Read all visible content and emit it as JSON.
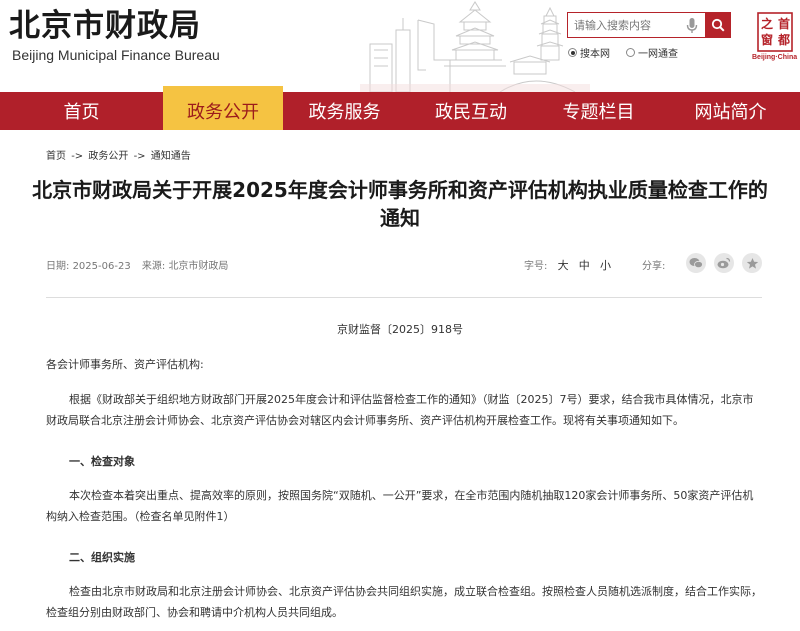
{
  "header": {
    "logo_cn": "北京市财政局",
    "logo_en": "Beijing Municipal Finance Bureau",
    "search_placeholder": "请输入搜索内容",
    "scope_options": [
      "搜本网",
      "一网通查"
    ],
    "seal_chars": [
      "首",
      "都",
      "之",
      "窗"
    ],
    "seal_caption": "Beijing·China",
    "accent_color": "#b0202a"
  },
  "nav": {
    "items": [
      "首页",
      "政务公开",
      "政务服务",
      "政民互动",
      "专题栏目",
      "网站简介"
    ],
    "active_index": 1,
    "active_color": "#f5c342"
  },
  "breadcrumb": [
    "首页",
    "->",
    "政务公开",
    "->",
    "通知通告"
  ],
  "article": {
    "title": "北京市财政局关于开展2025年度会计师事务所和资产评估机构执业质量检查工作的通知",
    "date_label": "日期:",
    "date": "2025-06-23",
    "source_label": "来源:",
    "source": "北京市财政局",
    "fontsize_label": "字号:",
    "fontsize_options": [
      "大",
      "中",
      "小"
    ],
    "share_label": "分享:",
    "share_icons": [
      "wechat-icon",
      "weibo-icon",
      "favorite-icon"
    ],
    "doc_number": "京财监督〔2025〕918号",
    "salutation": "各会计师事务所、资产评估机构:",
    "intro": "根据《财政部关于组织地方财政部门开展2025年度会计和评估监督检查工作的通知》（财监〔2025〕7号）要求，结合我市具体情况，北京市财政局联合北京注册会计师协会、北京资产评估协会对辖区内会计师事务所、资产评估机构开展检查工作。现将有关事项通知如下。",
    "section1_title": "一、检查对象",
    "section1_body": "本次检查本着突出重点、提高效率的原则，按照国务院“双随机、一公开”要求，在全市范围内随机抽取120家会计师事务所、50家资产评估机构纳入检查范围。（检查名单见附件1）",
    "section2_title": "二、组织实施",
    "section2_body": "检查由北京市财政局和北京注册会计师协会、北京资产评估协会共同组织实施，成立联合检查组。按照检查人员随机选派制度，结合工作实际，检查组分别由财政部门、协会和聘请中介机构人员共同组成。"
  }
}
